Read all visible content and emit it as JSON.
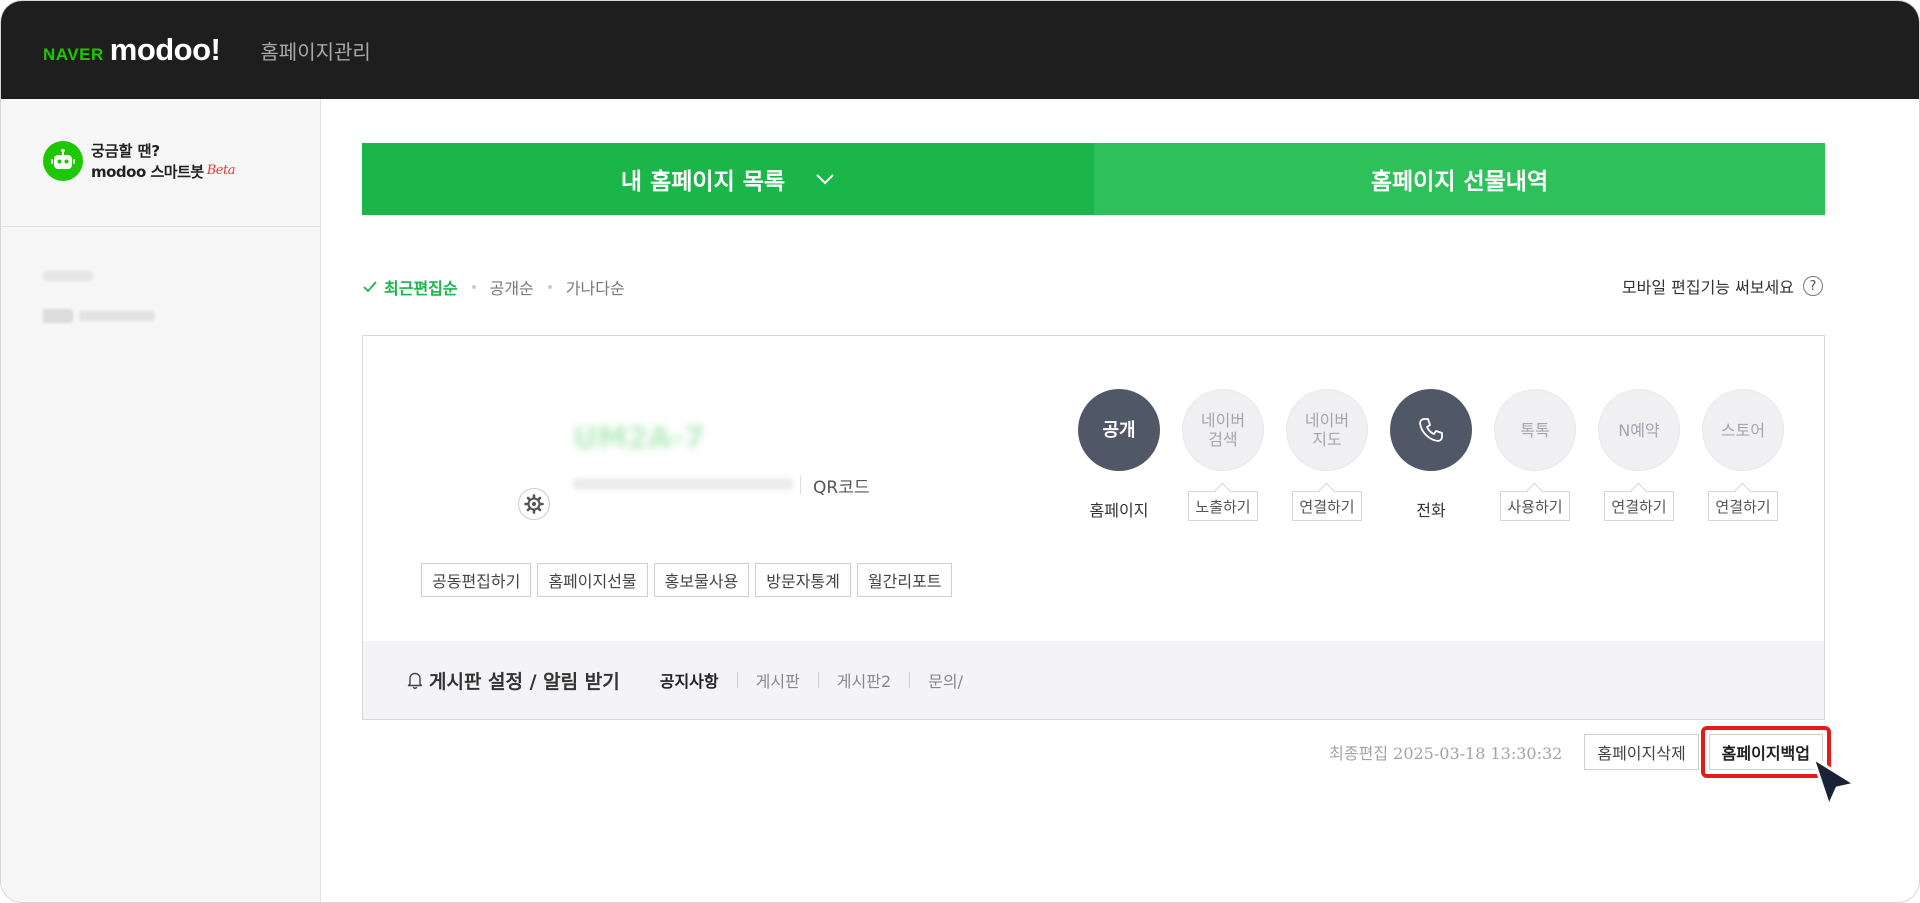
{
  "header": {
    "logo_naver": "NAVER",
    "logo_modoo": "modoo!",
    "title": "홈페이지관리"
  },
  "sidebar": {
    "bot_line1": "궁금할 땐?",
    "bot_line2": "modoo 스마트봇",
    "bot_beta": "Beta"
  },
  "tabs": {
    "my_list": "내 홈페이지 목록",
    "gift_history": "홈페이지 선물내역"
  },
  "sort": {
    "options": [
      "최근편집순",
      "공개순",
      "가나다순"
    ],
    "active": "최근편집순"
  },
  "mobile_hint": "모바일 편집기능 써보세요",
  "help_symbol": "?",
  "card": {
    "qr_label": "QR코드",
    "actions": [
      "공동편집하기",
      "홈페이지선물",
      "홍보물사용",
      "방문자통계",
      "월간리포트"
    ],
    "services": [
      {
        "circle": "공개",
        "state": "on",
        "label": "홈페이지",
        "button": ""
      },
      {
        "circle": "네이버\n검색",
        "state": "off",
        "label": "",
        "button": "노출하기"
      },
      {
        "circle": "네이버\n지도",
        "state": "off",
        "label": "",
        "button": "연결하기"
      },
      {
        "circle": "phone-icon",
        "state": "on",
        "label": "전화",
        "button": ""
      },
      {
        "circle": "톡톡",
        "state": "off",
        "label": "",
        "button": "사용하기"
      },
      {
        "circle": "N예약",
        "state": "off",
        "label": "",
        "button": "연결하기"
      },
      {
        "circle": "스토어",
        "state": "off",
        "label": "",
        "button": "연결하기"
      }
    ],
    "board": {
      "title": "게시판 설정 / 알림 받기",
      "items": [
        "공지사항",
        "게시판",
        "게시판2",
        "문의/"
      ]
    }
  },
  "footer": {
    "last_edit_label": "최종편집",
    "last_edit_value": "2025-03-18 13:30:32",
    "delete_button": "홈페이지삭제",
    "backup_button": "홈페이지백업"
  },
  "colors": {
    "brand_green": "#1ab64a",
    "topbar": "#1e1e1e",
    "circle_on": "#505767",
    "highlight": "#e21b1b"
  }
}
